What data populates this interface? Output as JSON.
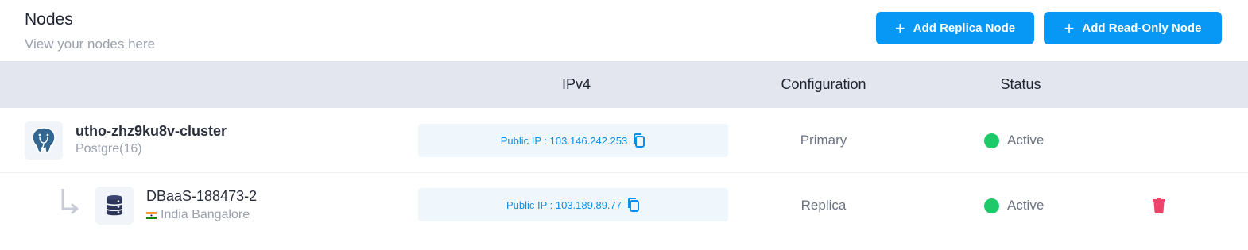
{
  "header": {
    "title": "Nodes",
    "subtitle": "View your nodes here",
    "buttons": {
      "add_replica": "Add Replica Node",
      "add_readonly": "Add Read-Only Node"
    }
  },
  "table": {
    "columns": [
      "IPv4",
      "Configuration",
      "Status"
    ],
    "rows": [
      {
        "name": "utho-zhz9ku8v-cluster",
        "subtitle": "Postgre(16)",
        "ip": "Public IP : 103.146.242.253",
        "config": "Primary",
        "status": "Active",
        "icon": "postgres-elephant-icon"
      },
      {
        "name": "DBaaS-188473-2",
        "subtitle": "India Bangalore",
        "ip": "Public IP : 103.189.89.77",
        "config": "Replica",
        "status": "Active",
        "icon": "database-icon"
      }
    ]
  },
  "colors": {
    "accent": "#0797f5",
    "status_active": "#1ec969",
    "delete": "#f0436b",
    "header_bg": "#e3e6ee"
  }
}
